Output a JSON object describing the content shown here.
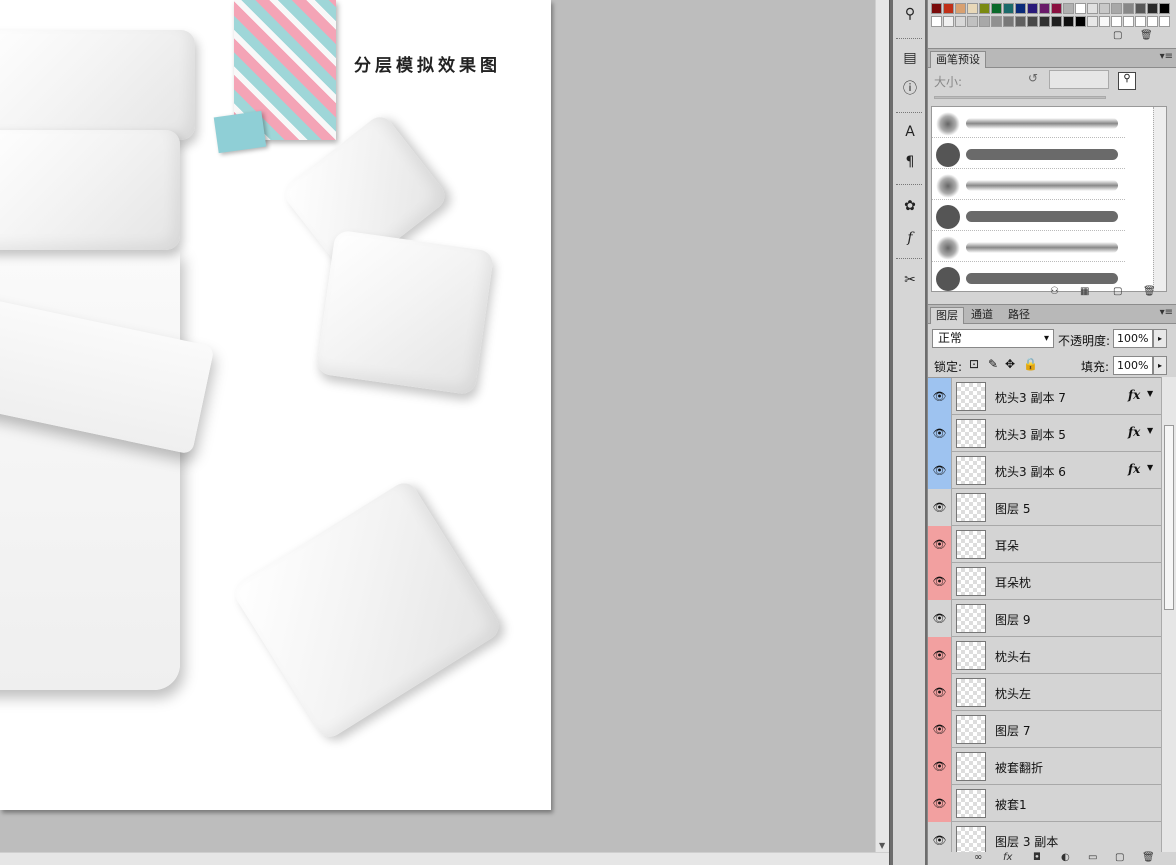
{
  "document": {
    "title": "分层模拟效果图"
  },
  "brush_panel": {
    "tab": "画笔预设",
    "size_label": "大小:"
  },
  "layers_panel": {
    "tabs": [
      "图层",
      "通道",
      "路径"
    ],
    "blend_mode": "正常",
    "opacity_label": "不透明度:",
    "opacity_value": "100%",
    "lock_label": "锁定:",
    "fill_label": "填充:",
    "fill_value": "100%",
    "layers": [
      {
        "name": "枕头3 副本 7",
        "color": "#9ec3f0",
        "fx": "fx"
      },
      {
        "name": "枕头3 副本 5",
        "color": "#9ec3f0",
        "fx": "fx"
      },
      {
        "name": "枕头3 副本 6",
        "color": "#9ec3f0",
        "fx": "fx"
      },
      {
        "name": "图层 5",
        "color": "#d4d4d4",
        "fx": ""
      },
      {
        "name": "耳朵",
        "color": "#f2a0a0",
        "fx": ""
      },
      {
        "name": "耳朵枕",
        "color": "#f2a0a0",
        "fx": ""
      },
      {
        "name": "图层 9",
        "color": "#d4d4d4",
        "fx": ""
      },
      {
        "name": "枕头右",
        "color": "#f2a0a0",
        "fx": ""
      },
      {
        "name": "枕头左",
        "color": "#f2a0a0",
        "fx": ""
      },
      {
        "name": "图层 7",
        "color": "#f2a0a0",
        "fx": ""
      },
      {
        "name": "被套翻折",
        "color": "#f2a0a0",
        "fx": ""
      },
      {
        "name": "被套1",
        "color": "#f2a0a0",
        "fx": ""
      },
      {
        "name": "图层 3 副本",
        "color": "#d4d4d4",
        "fx": ""
      }
    ]
  },
  "icons": {
    "eye": "eye-icon",
    "fx": "fx-icon"
  }
}
